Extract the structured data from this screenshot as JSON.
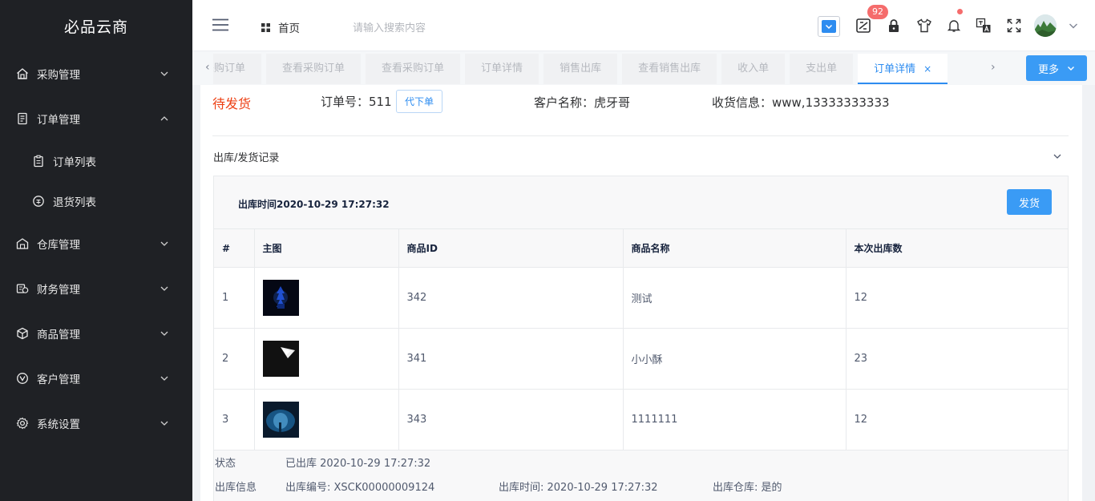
{
  "app": {
    "logo": "必品云商"
  },
  "sidebar": {
    "items": [
      {
        "label": "采购管理",
        "icon": "home-icon",
        "expanded": false
      },
      {
        "label": "订单管理",
        "icon": "document-icon",
        "expanded": true,
        "children": [
          {
            "label": "订单列表",
            "icon": "clipboard-icon"
          },
          {
            "label": "退货列表",
            "icon": "return-icon"
          }
        ]
      },
      {
        "label": "仓库管理",
        "icon": "warehouse-icon",
        "expanded": false
      },
      {
        "label": "财务管理",
        "icon": "finance-icon",
        "expanded": false
      },
      {
        "label": "商品管理",
        "icon": "package-icon",
        "expanded": false
      },
      {
        "label": "客户管理",
        "icon": "customer-icon",
        "expanded": false
      },
      {
        "label": "系统设置",
        "icon": "gear-icon",
        "expanded": false
      }
    ]
  },
  "header": {
    "home_label": "首页",
    "search_placeholder": "请输入搜索内容",
    "badge_count": "92",
    "icons": [
      "select-icon",
      "ticket-icon",
      "lock-icon",
      "shirt-icon",
      "bell-icon",
      "translate-icon",
      "fullscreen-icon",
      "avatar",
      "chevron-down-icon"
    ]
  },
  "tabs": {
    "items": [
      "采购订单",
      "查看采购订单",
      "查看采购订单",
      "订单详情",
      "销售出库",
      "查看销售出库",
      "收入单",
      "支出单",
      "订单详情"
    ],
    "active_index": 8,
    "more_label": "更多"
  },
  "order": {
    "status": "待发货",
    "order_no": "订单号：511",
    "proxy_button": "代下单",
    "customer": "客户名称：虎牙哥",
    "shipping": "收货信息：www,13333333333"
  },
  "panel": {
    "title": "出库/发货记录",
    "record_time": "出库时间2020-10-29 17:27:32",
    "ship_button": "发货",
    "columns": [
      "#",
      "主图",
      "商品ID",
      "商品名称",
      "本次出库数"
    ],
    "rows": [
      {
        "index": "1",
        "product_id": "342",
        "name": "测试",
        "qty": "12"
      },
      {
        "index": "2",
        "product_id": "341",
        "name": "小小酥",
        "qty": "23"
      },
      {
        "index": "3",
        "product_id": "343",
        "name": "1111111",
        "qty": "12"
      }
    ],
    "status_label": "状态",
    "status_value": "已出库 2020-10-29 17:27:32",
    "info_label": "出库信息",
    "info_no": "出库编号: XSCK00000009124",
    "info_time": "出库时间: 2020-10-29 17:27:32",
    "info_warehouse": "出库仓库: 是的"
  },
  "colors": {
    "sidebar_bg": "#1f2125",
    "primary": "#2d8cf0",
    "status_red": "#ed4014",
    "badge": "#f56c6c"
  }
}
